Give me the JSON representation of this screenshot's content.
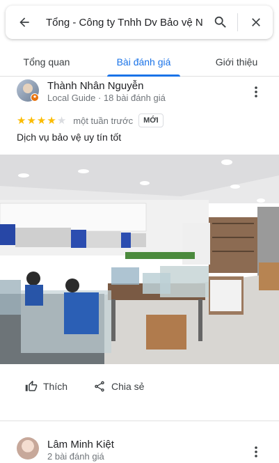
{
  "search": {
    "query": "Tổng - Công ty Tnhh Dv Bảo vệ N",
    "back_icon": "arrow-back-icon",
    "search_icon": "search-icon",
    "close_icon": "close-icon"
  },
  "tabs": [
    {
      "label": "Tổng quan",
      "active": false
    },
    {
      "label": "Bài đánh giá",
      "active": true
    },
    {
      "label": "Giới thiệu",
      "active": false
    }
  ],
  "colors": {
    "accent": "#1a73e8",
    "star": "#fbbc04",
    "badge": "#e8710a"
  },
  "reviews": [
    {
      "name": "Thành Nhân Nguyễn",
      "meta": "Local Guide · 18 bài đánh giá",
      "rating": 4,
      "max_rating": 5,
      "time": "một tuần trước",
      "badge": "MỚI",
      "text": "Dịch vụ bảo vệ uy tín tốt",
      "photo_icon": "office-photo",
      "actions": {
        "like": "Thích",
        "share": "Chia sẻ"
      }
    },
    {
      "name": "Lâm Minh Kiệt",
      "meta": "2 bài đánh giá"
    }
  ]
}
